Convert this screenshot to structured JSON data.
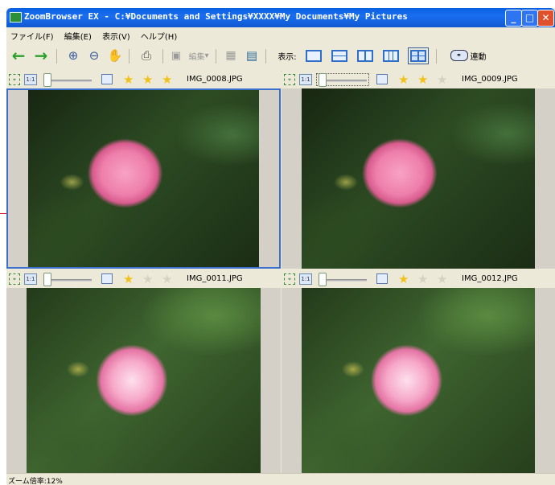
{
  "window": {
    "title": "ZoomBrowser EX - C:¥Documents and Settings¥XXXX¥My Documents¥My Pictures"
  },
  "menu": [
    {
      "label": "ファイル(F)"
    },
    {
      "label": "編集(E)"
    },
    {
      "label": "表示(V)"
    },
    {
      "label": "ヘルプ(H)"
    }
  ],
  "toolbar": {
    "edit_label": "編集",
    "display_label": "表示:",
    "sync_label": "連動",
    "back_icon": "back-arrow-icon",
    "forward_icon": "forward-arrow-icon"
  },
  "panes": [
    {
      "filename": "IMG_0008.JPG",
      "rating": 3,
      "selected": true
    },
    {
      "filename": "IMG_0009.JPG",
      "rating": 2,
      "selected": false
    },
    {
      "filename": "IMG_0011.JPG",
      "rating": 1,
      "selected": false
    },
    {
      "filename": "IMG_0012.JPG",
      "rating": 1,
      "selected": false
    }
  ],
  "status": {
    "zoom": "ズーム倍率:12%"
  },
  "colors": {
    "title_bar": "#1a6ef0",
    "accent": "#2f6fc8",
    "star": "#f3c21a"
  }
}
